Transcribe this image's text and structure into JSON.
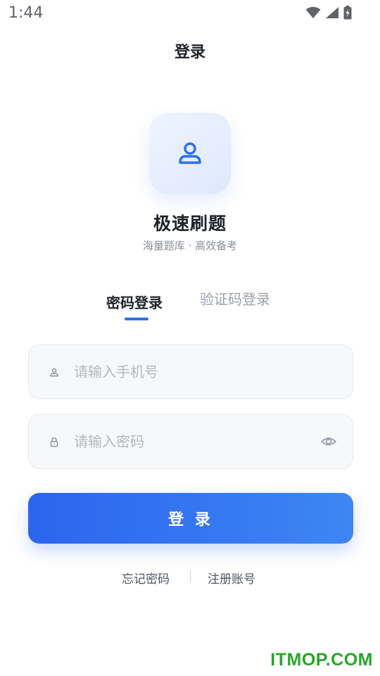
{
  "status_bar": {
    "time": "1:44"
  },
  "header": {
    "title": "登录"
  },
  "app": {
    "name": "极速刷题",
    "slogan": "海量题库 · 高效备考",
    "logo_icon": "user-icon"
  },
  "tabs": [
    {
      "label": "密码登录",
      "active": true
    },
    {
      "label": "验证码登录",
      "active": false
    }
  ],
  "form": {
    "phone": {
      "placeholder": "请输入手机号",
      "value": "",
      "icon": "person-icon"
    },
    "password": {
      "placeholder": "请输入密码",
      "value": "",
      "icon": "lock-icon",
      "toggle_icon": "eye-icon"
    },
    "submit_label": "登 录"
  },
  "links": {
    "forgot": "忘记密码",
    "register": "注册账号"
  },
  "watermark": "ITMOP.COM",
  "colors": {
    "accent": "#2f6ef0",
    "text": "#1f2329",
    "muted": "#9aa1ab",
    "watermark": "#2aa52a"
  }
}
